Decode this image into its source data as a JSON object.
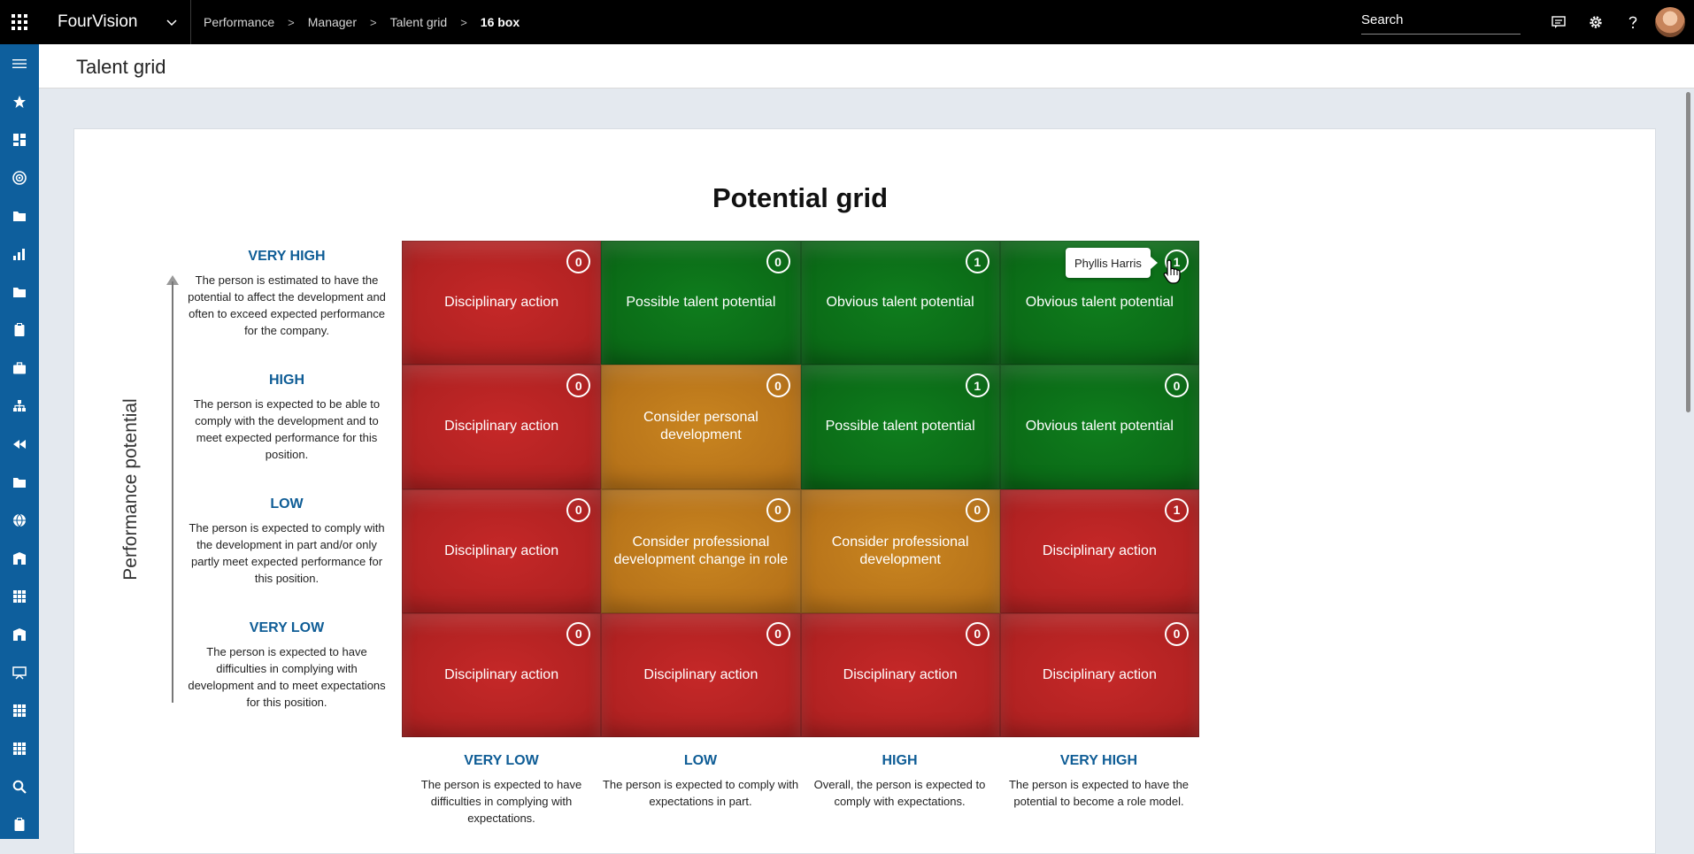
{
  "app": {
    "name": "FourVision",
    "breadcrumb": [
      "Performance",
      "Manager",
      "Talent grid",
      "16 box"
    ]
  },
  "search": {
    "label": "Search"
  },
  "page": {
    "title": "Talent grid"
  },
  "grid": {
    "title": "Potential grid",
    "y_axis_label": "Performance potential",
    "y_levels": [
      {
        "title": "VERY HIGH",
        "desc": "The person is estimated to have the potential to affect the development and often to exceed expected performance for the company."
      },
      {
        "title": "HIGH",
        "desc": "The person is expected to be able to comply with the development and to meet expected performance for this position."
      },
      {
        "title": "LOW",
        "desc": "The person is expected to comply with the development in part and/or only partly meet expected performance for this position."
      },
      {
        "title": "VERY LOW",
        "desc": "The person is expected to have difficulties in complying with development and to meet expectations for this position."
      }
    ],
    "x_levels": [
      {
        "title": "VERY LOW",
        "desc": "The person is expected to have difficulties in complying with expectations."
      },
      {
        "title": "LOW",
        "desc": "The person is expected to comply with expectations in part."
      },
      {
        "title": "HIGH",
        "desc": "Overall, the person is expected to comply with expectations."
      },
      {
        "title": "VERY HIGH",
        "desc": "The person is expected to have the potential to become a role model."
      }
    ],
    "rows": [
      [
        {
          "label": "Disciplinary action",
          "count": "0",
          "color": "red"
        },
        {
          "label": "Possible talent potential",
          "count": "0",
          "color": "green"
        },
        {
          "label": "Obvious talent potential",
          "count": "1",
          "color": "green"
        },
        {
          "label": "Obvious talent potential",
          "count": "1",
          "color": "green"
        }
      ],
      [
        {
          "label": "Disciplinary action",
          "count": "0",
          "color": "red"
        },
        {
          "label": "Consider personal development",
          "count": "0",
          "color": "orange"
        },
        {
          "label": "Possible talent potential",
          "count": "1",
          "color": "green"
        },
        {
          "label": "Obvious talent potential",
          "count": "0",
          "color": "green"
        }
      ],
      [
        {
          "label": "Disciplinary action",
          "count": "0",
          "color": "red"
        },
        {
          "label": "Consider professional development change in role",
          "count": "0",
          "color": "orange"
        },
        {
          "label": "Consider professional development",
          "count": "0",
          "color": "orange"
        },
        {
          "label": "Disciplinary action",
          "count": "1",
          "color": "red"
        }
      ],
      [
        {
          "label": "Disciplinary action",
          "count": "0",
          "color": "red"
        },
        {
          "label": "Disciplinary action",
          "count": "0",
          "color": "red"
        },
        {
          "label": "Disciplinary action",
          "count": "0",
          "color": "red"
        },
        {
          "label": "Disciplinary action",
          "count": "0",
          "color": "red"
        }
      ]
    ]
  },
  "tooltip": {
    "text": "Phyllis Harris"
  },
  "colors": {
    "red": "#b22222",
    "green": "#0b6b17",
    "orange": "#b8741a",
    "nav": "#0e5f9d",
    "accent": "#0f5d96"
  },
  "nav_icons": [
    "menu-icon",
    "favorites-icon",
    "dashboard-icon",
    "goals-icon",
    "folder-icon",
    "chart-icon",
    "folder-icon",
    "clipboard-icon",
    "briefcase-icon",
    "org-chart-icon",
    "rewind-icon",
    "folder-icon",
    "globe-icon",
    "building-icon",
    "apps-icon",
    "building-icon",
    "training-icon",
    "apps-icon",
    "apps-icon",
    "search-icon",
    "clipboard-icon"
  ]
}
